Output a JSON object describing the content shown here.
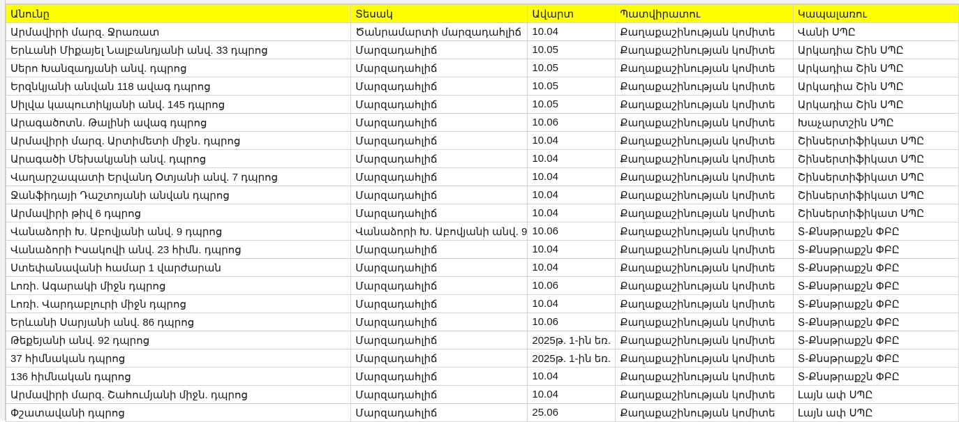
{
  "sheet": {
    "header_color": "#ffff00",
    "headers": [
      "Անունը",
      "Տեսակ",
      "Ավարտ",
      "Պատվիրատու",
      "Կապալառու"
    ],
    "rows": [
      [
        "Արմավիրի մարզ. Ջրառատ",
        "Ծանրամարտի մարզադահլիճ",
        "10.04",
        "Քաղաքաշինության կոմիտե",
        "Վանի ՍՊԸ"
      ],
      [
        "Երևանի Միքայել Նալբանդյանի անվ. 33 դպրոց",
        "Մարզադահլիճ",
        "10.05",
        "Քաղաքաշինության կոմիտե",
        "Արկադիա Շին ՍՊԸ"
      ],
      [
        "Սերո Խանզադյանի անվ. դպրոց",
        "Մարզադահլիճ",
        "10.05",
        "Քաղաքաշինության կոմիտե",
        "Արկադիա Շին ՍՊԸ"
      ],
      [
        "Երզնկյանի անվան 118 ավագ դպրոց",
        "Մարզադահլիճ",
        "10.05",
        "Քաղաքաշինության կոմիտե",
        "Արկադիա Շին ՍՊԸ"
      ],
      [
        "Սիլվա կապուտիկյանի անվ. 145 դպրոց",
        "Մարզադահլիճ",
        "10.05",
        "Քաղաքաշինության կոմիտե",
        "Արկադիա Շին ՍՊԸ"
      ],
      [
        "Արագածոտն. Թալինի ավագ դպրոց",
        "Մարզադահլիճ",
        "10.06",
        "Քաղաքաշինության կոմիտե",
        "Խաչարտշին ՍՊԸ"
      ],
      [
        "Արմավիրի մարզ. Արտիմետի միջն. դպրոց",
        "Մարզադահլիճ",
        "10.04",
        "Քաղաքաշինության կոմիտե",
        "Շինսերտիֆիկատ ՍՊԸ"
      ],
      [
        "Արագածի Մեխակյանի անվ. դպրոց",
        "Մարզադահլիճ",
        "10.04",
        "Քաղաքաշինության կոմիտե",
        "Շինսերտիֆիկատ ՍՊԸ"
      ],
      [
        "Վաղարշապատի Երվանդ Օտյանի անվ. 7 դպրոց",
        "Մարզադահլիճ",
        "10.04",
        "Քաղաքաշինության կոմիտե",
        "Շինսերտիֆիկատ ՍՊԸ"
      ],
      [
        "Ջանֆիդայի Դաշտոյանի անվան դպրոց",
        "Մարզադահլիճ",
        "10.04",
        "Քաղաքաշինության կոմիտե",
        "Շինսերտիֆիկատ ՍՊԸ"
      ],
      [
        "Արմավիրի թիվ 6 դպրոց",
        "Մարզադահլիճ",
        "10.04",
        "Քաղաքաշինության կոմիտե",
        "Շինսերտիֆիկատ ՍՊԸ"
      ],
      [
        "Վանաձորի Խ. Աբովյանի անվ. 9 դպրոց",
        "Վանաձորի Խ. Աբովյանի անվ. 9",
        "10.06",
        "Քաղաքաշինության կոմիտե",
        "Տ-Քնսթրաքշն ՓԲԸ"
      ],
      [
        "Վանաձորի Իսակովի անվ. 23 հիմն. դպրոց",
        "Մարզադահլիճ",
        "10.04",
        "Քաղաքաշինության կոմիտե",
        "Տ-Քնսթրաքշն ՓԲԸ"
      ],
      [
        "Ստեփանավանի համար 1 վարժարան",
        "Մարզադահլիճ",
        "10.04",
        "Քաղաքաշինության կոմիտե",
        "Տ-Քնսթրաքշն ՓԲԸ"
      ],
      [
        "Լոռի. Ագարակի միջն դպրոց",
        "Մարզադահլիճ",
        "10.06",
        "Քաղաքաշինության կոմիտե",
        "Տ-Քնսթրաքշն ՓԲԸ"
      ],
      [
        "Լոռի. Վարդաբլուրի միջն դպրոց",
        "Մարզադահլիճ",
        "10.04",
        "Քաղաքաշինության կոմիտե",
        "Տ-Քնսթրաքշն ՓԲԸ"
      ],
      [
        "Երևանի Սարյանի անվ. 86 դպրոց",
        "Մարզադահլիճ",
        "10.06",
        "Քաղաքաշինության կոմիտե",
        "Տ-Քնսթրաքշն ՓԲԸ"
      ],
      [
        "Թեքեյանի անվ. 92 դպրոց",
        "Մարզադահլիճ",
        "2025թ. 1-ին եռ.",
        "Քաղաքաշինության կոմիտե",
        "Տ-Քնսթրաքշն ՓԲԸ"
      ],
      [
        "37 հիմնական դպրոց",
        "Մարզադահլիճ",
        "2025թ. 1-ին եռ.",
        "Քաղաքաշինության կոմիտե",
        "Տ-Քնսթրաքշն ՓԲԸ"
      ],
      [
        "136 հիմնական դպրոց",
        "Մարզադահլիճ",
        "10.04",
        "Քաղաքաշինության կոմիտե",
        "Տ-Քնսթրաքշն ՓԲԸ"
      ],
      [
        "Արմավիրի մարզ. Շահումյանի միջն. դպրոց",
        "Մարզադահլիճ",
        "10.04",
        "Քաղաքաշինության կոմիտե",
        "Լայն ափ ՍՊԸ"
      ],
      [
        "Փշատավանի դպրոց",
        "Մարզադահլիճ",
        "25.06",
        "Քաղաքաշինության կոմիտե",
        "Լայն ափ ՍՊԸ"
      ]
    ]
  }
}
